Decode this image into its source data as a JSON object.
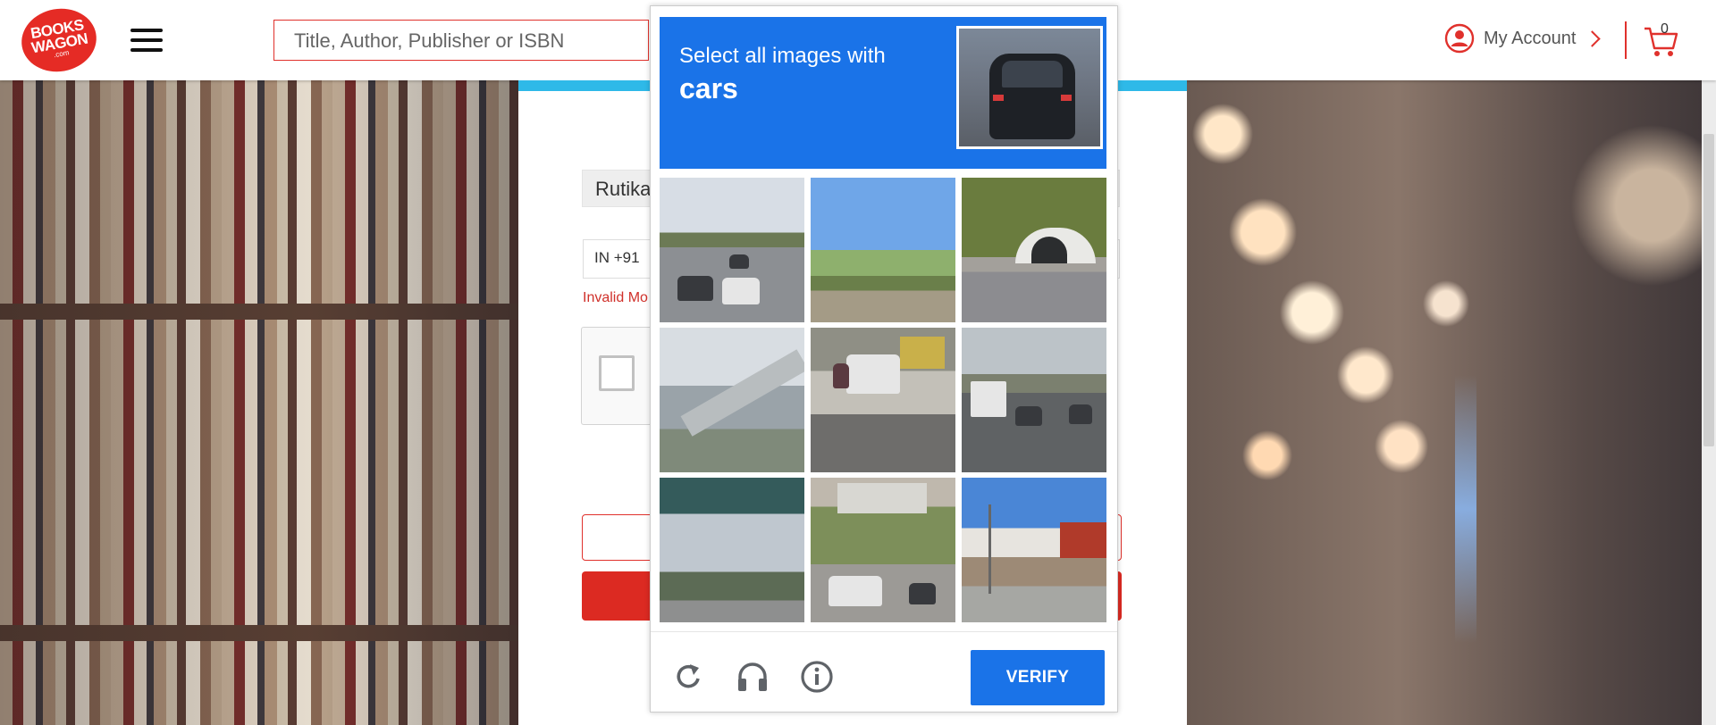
{
  "header": {
    "logo_line1": "BOOKS",
    "logo_line2": "WAGON",
    "logo_line3": ".com",
    "search_placeholder": "Title, Author, Publisher or ISBN",
    "account_label": "My Account",
    "cart_count": "0",
    "brand_color": "#e0312c"
  },
  "form": {
    "name_value": "Rutika",
    "phone_code": "IN +91",
    "error_text": "Invalid Mo"
  },
  "captcha": {
    "prompt_line1": "Select all images with",
    "prompt_object": "cars",
    "verify_label": "VERIFY",
    "accent_color": "#1a73e8",
    "tiles": [
      "tile-1",
      "tile-2",
      "tile-3",
      "tile-4",
      "tile-5",
      "tile-6",
      "tile-7",
      "tile-8",
      "tile-9"
    ],
    "footer_icons": [
      "reload-icon",
      "headphones-icon",
      "info-icon"
    ]
  }
}
